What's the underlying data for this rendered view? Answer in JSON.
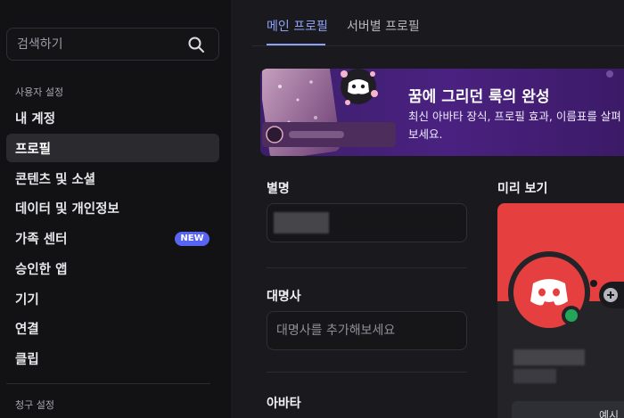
{
  "sidebar": {
    "search_placeholder": "검색하기",
    "section_user": "사용자 설정",
    "items": [
      {
        "label": "내 계정"
      },
      {
        "label": "프로필"
      },
      {
        "label": "콘텐츠 및 소셜"
      },
      {
        "label": "데이터 및 개인정보"
      },
      {
        "label": "가족 센터",
        "badge": "NEW"
      },
      {
        "label": "승인한 앱"
      },
      {
        "label": "기기"
      },
      {
        "label": "연결"
      },
      {
        "label": "클립"
      }
    ],
    "section_billing": "청구 설정"
  },
  "tabs": [
    {
      "label": "메인 프로필"
    },
    {
      "label": "서버별 프로필"
    }
  ],
  "banner": {
    "headline": "꿈에 그리던 룩의 완성",
    "description": "최신 아바타 장식, 프로필 효과, 이름표를 살펴보세요."
  },
  "fields": {
    "nickname_label": "별명",
    "pronouns_label": "대명사",
    "pronouns_placeholder": "대명사를 추가해보세요",
    "avatar_label": "아바타"
  },
  "preview": {
    "label": "미리 보기",
    "button_label": "예시"
  },
  "colors": {
    "accent": "#5865f2",
    "tab_active": "#8ea1f8",
    "preview_banner": "#e5403f",
    "status_online": "#23a55a"
  }
}
